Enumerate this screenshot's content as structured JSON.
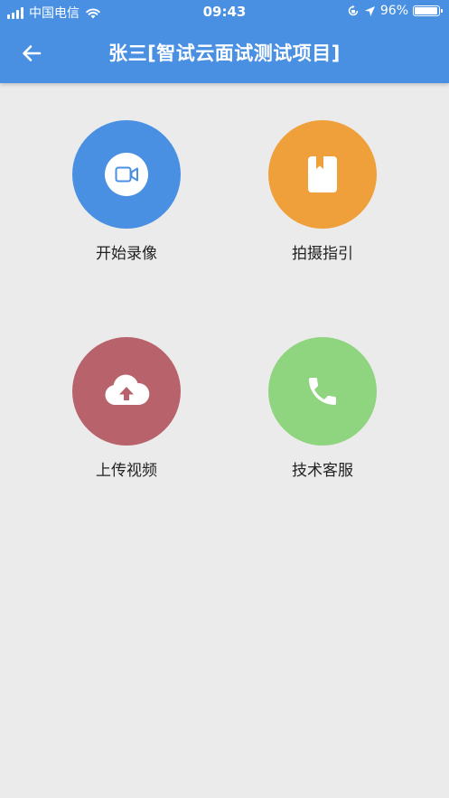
{
  "status_bar": {
    "carrier": "中国电信",
    "time": "09:43",
    "battery": "96%",
    "battery_level": 0.96
  },
  "header": {
    "title": "张三[智试云面试测试项目]",
    "back_icon": "arrow-left-icon"
  },
  "actions": [
    {
      "label": "开始录像",
      "icon": "video-camera-icon",
      "color": "#4a90e2"
    },
    {
      "label": "拍摄指引",
      "icon": "book-icon",
      "color": "#f0a03a"
    },
    {
      "label": "上传视频",
      "icon": "cloud-upload-icon",
      "color": "#b8626b"
    },
    {
      "label": "技术客服",
      "icon": "phone-icon",
      "color": "#8fd47e"
    }
  ],
  "colors": {
    "appbar": "#4a90e2",
    "background": "#ebebeb"
  }
}
